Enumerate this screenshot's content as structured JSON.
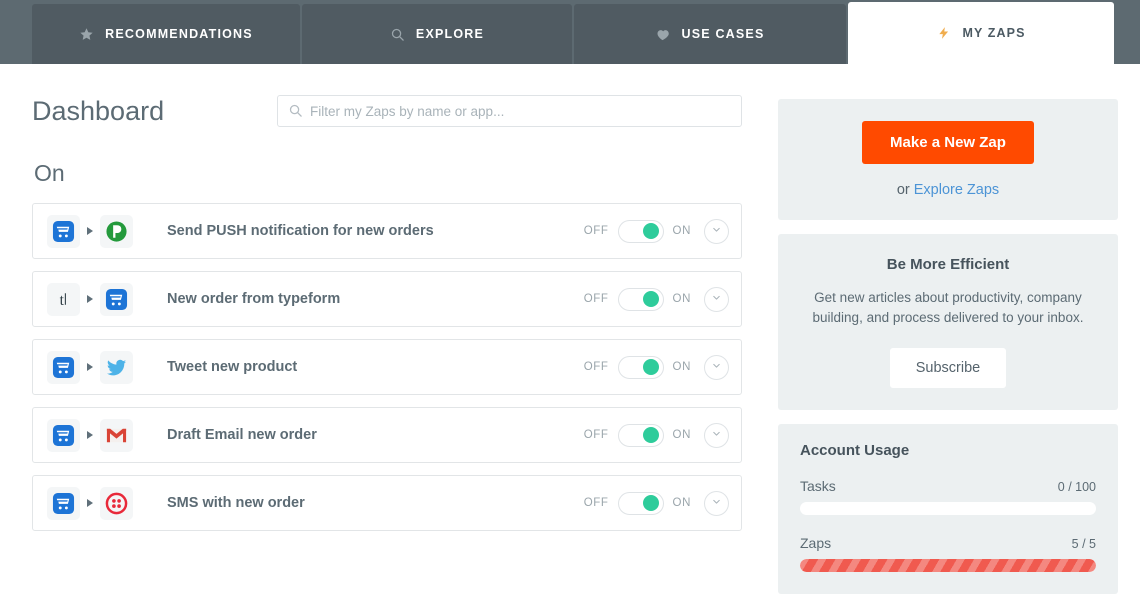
{
  "nav": {
    "tabs": [
      {
        "label": "RECOMMENDATIONS",
        "icon": "star-icon",
        "active": false
      },
      {
        "label": "EXPLORE",
        "icon": "search-icon",
        "active": false
      },
      {
        "label": "USE CASES",
        "icon": "heart-icon",
        "active": false
      },
      {
        "label": "MY ZAPS",
        "icon": "lightning-bolt-icon",
        "active": true
      }
    ],
    "active_tab_accent": "#f0ad4e",
    "bar_color": "#5d6a71",
    "tab_color": "#505b62"
  },
  "header": {
    "title": "Dashboard",
    "search": {
      "placeholder": "Filter my Zaps by name or app...",
      "value": "",
      "icon": "search-icon"
    }
  },
  "main": {
    "section_title": "On",
    "zaps": [
      {
        "title": "Send PUSH notification for new orders",
        "trigger_app": "shopping-cart-icon",
        "action_app": "pushover-icon",
        "toggle": {
          "off_label": "OFF",
          "on_label": "ON",
          "state": "on"
        },
        "expand_icon": "chevron-down-icon"
      },
      {
        "title": "New order from typeform",
        "trigger_app": "typeform-icon",
        "action_app": "shopping-cart-icon",
        "toggle": {
          "off_label": "OFF",
          "on_label": "ON",
          "state": "on"
        },
        "expand_icon": "chevron-down-icon"
      },
      {
        "title": "Tweet new product",
        "trigger_app": "shopping-cart-icon",
        "action_app": "twitter-icon",
        "toggle": {
          "off_label": "OFF",
          "on_label": "ON",
          "state": "on"
        },
        "expand_icon": "chevron-down-icon"
      },
      {
        "title": "Draft Email new order",
        "trigger_app": "shopping-cart-icon",
        "action_app": "gmail-icon",
        "toggle": {
          "off_label": "OFF",
          "on_label": "ON",
          "state": "on"
        },
        "expand_icon": "chevron-down-icon"
      },
      {
        "title": "SMS with new order",
        "trigger_app": "shopping-cart-icon",
        "action_app": "twilio-icon",
        "toggle": {
          "off_label": "OFF",
          "on_label": "ON",
          "state": "on"
        },
        "expand_icon": "chevron-down-icon"
      }
    ]
  },
  "sidebar": {
    "cta": {
      "button_label": "Make a New Zap",
      "button_color": "#ff4a00",
      "or_text": "or ",
      "link_label": "Explore Zaps",
      "link_color": "#4c94d6"
    },
    "newsletter": {
      "title": "Be More Efficient",
      "body": "Get new articles about productivity, company building, and process delivered to your inbox.",
      "button_label": "Subscribe"
    },
    "usage": {
      "title": "Account Usage",
      "items": [
        {
          "label": "Tasks",
          "value": "0 / 100",
          "used": 0,
          "limit": 100,
          "percent": 0,
          "fill_color": "#ffffff"
        },
        {
          "label": "Zaps",
          "value": "5 / 5",
          "used": 5,
          "limit": 5,
          "percent": 100,
          "fill_color": "#f05a4f"
        }
      ]
    }
  }
}
